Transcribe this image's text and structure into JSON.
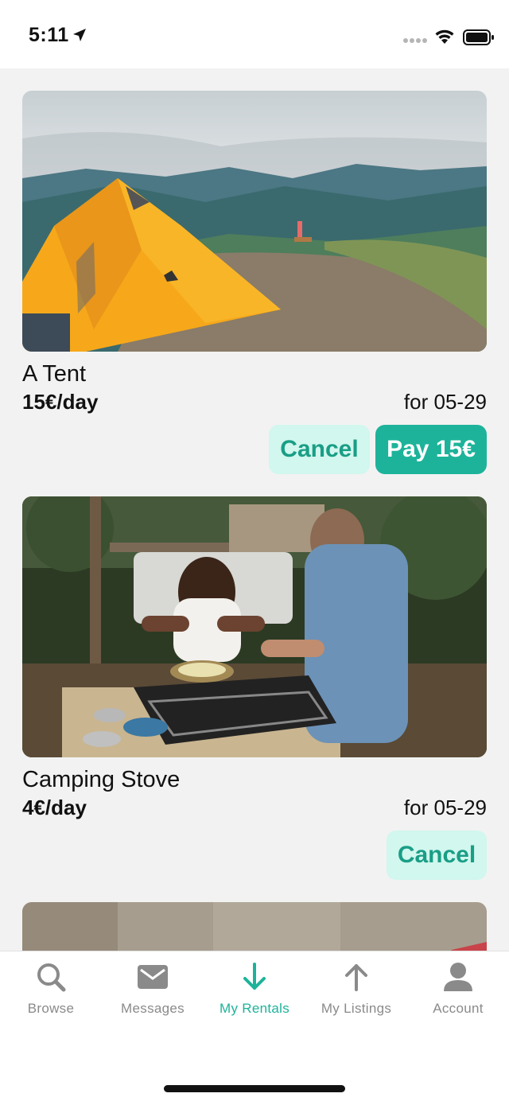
{
  "status_bar": {
    "time": "5:11"
  },
  "rentals": [
    {
      "image": "tent-photo",
      "title": "A Tent",
      "price": "15€/day",
      "date": "for 05-29",
      "cancel_label": "Cancel",
      "pay_label": "Pay 15€"
    },
    {
      "image": "camping-stove-photo",
      "title": "Camping Stove",
      "price": "4€/day",
      "date": "for 05-29",
      "cancel_label": "Cancel"
    }
  ],
  "tabs": [
    {
      "label": "Browse",
      "icon": "search-icon"
    },
    {
      "label": "Messages",
      "icon": "mail-icon"
    },
    {
      "label": "My Rentals",
      "icon": "arrow-down-icon",
      "active": true
    },
    {
      "label": "My Listings",
      "icon": "arrow-up-icon"
    },
    {
      "label": "Account",
      "icon": "person-icon"
    }
  ],
  "colors": {
    "accent": "#1db39a",
    "accent_light": "#d1f7ee",
    "tab_inactive": "#8a8a8a",
    "background": "#f2f2f2"
  }
}
